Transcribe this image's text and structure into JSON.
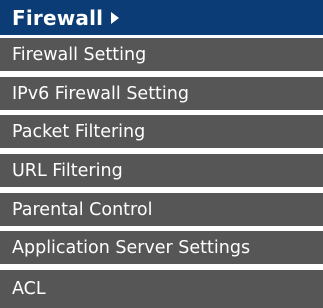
{
  "menu": {
    "header_label": "Firewall",
    "items": [
      {
        "label": "Firewall Setting"
      },
      {
        "label": "IPv6 Firewall Setting"
      },
      {
        "label": "Packet Filtering"
      },
      {
        "label": "URL Filtering"
      },
      {
        "label": "Parental Control"
      },
      {
        "label": "Application Server Settings"
      },
      {
        "label": "ACL"
      }
    ]
  },
  "colors": {
    "header_bg": "#0c3c76",
    "item_bg": "#565656",
    "text": "#ffffff",
    "separator": "#ffffff"
  },
  "icons": {
    "header_icon": "triangle-right-icon"
  }
}
